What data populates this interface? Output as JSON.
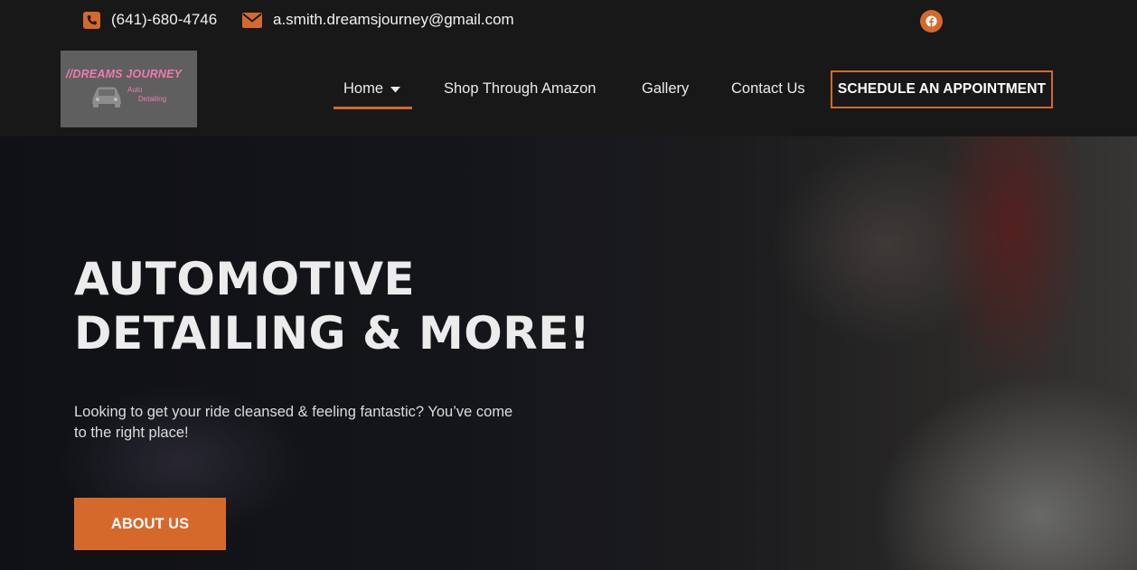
{
  "topbar": {
    "phone": "(641)-680-4746",
    "email": "a.smith.dreamsjourney@gmail.com",
    "phone_icon": "phone-icon",
    "email_icon": "envelope-icon",
    "social_icon": "facebook-icon"
  },
  "logo": {
    "title": "//DREAMS JOURNEY",
    "sub1": "Auto",
    "sub2": "Detailing"
  },
  "nav": {
    "items": [
      {
        "label": "Home",
        "active": true
      },
      {
        "label": "Shop Through Amazon"
      },
      {
        "label": "Gallery"
      },
      {
        "label": "Contact Us"
      }
    ],
    "cta": "SCHEDULE AN APPOINTMENT"
  },
  "hero": {
    "title_line1": "AUTOMOTIVE",
    "title_line2": "DETAILING & MORE!",
    "subtitle": "Looking to get your ride cleansed & feeling fantastic? You’ve come to the right place!",
    "button": "ABOUT US"
  },
  "colors": {
    "accent": "#d5692c",
    "background": "#181818",
    "logo_pink": "#f07ab0"
  }
}
